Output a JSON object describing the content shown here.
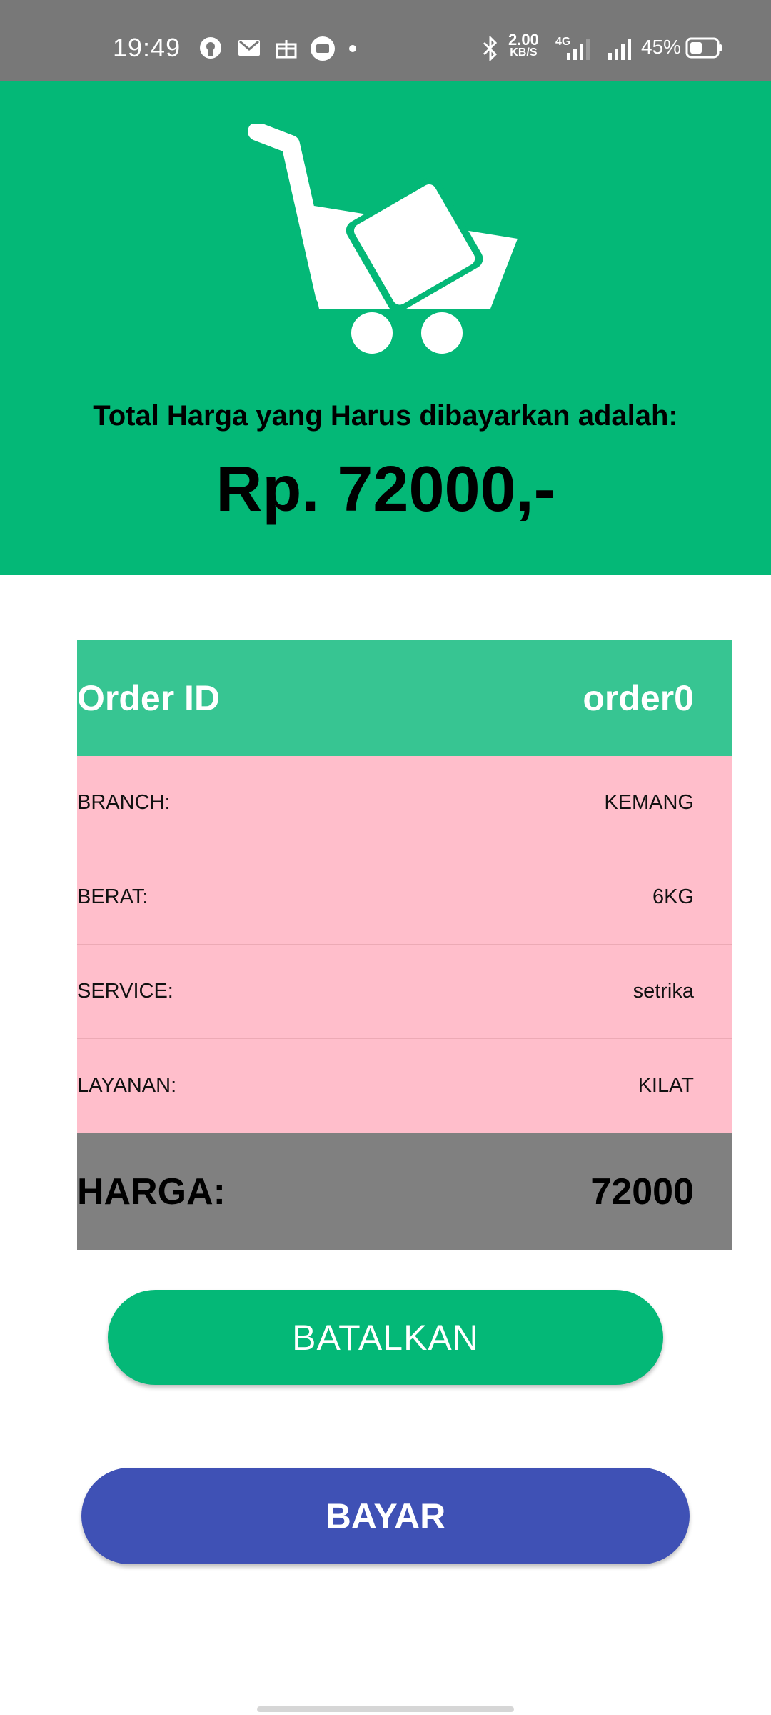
{
  "status_bar": {
    "time": "19:49",
    "net_speed_value": "2.00",
    "net_speed_unit": "KB/S",
    "network_type": "4G",
    "battery": "45%"
  },
  "hero": {
    "icon": "shopping-cart-icon",
    "subtitle": "Total Harga yang Harus dibayarkan adalah:",
    "total": "Rp. 72000,-"
  },
  "order": {
    "header_label": "Order ID",
    "header_value": "order0",
    "rows": [
      {
        "label": "BRANCH:",
        "value": "KEMANG"
      },
      {
        "label": "BERAT:",
        "value": "6KG"
      },
      {
        "label": "SERVICE:",
        "value": "setrika"
      },
      {
        "label": "LAYANAN:",
        "value": "KILAT"
      }
    ],
    "price_label": "HARGA:",
    "price_value": "72000"
  },
  "buttons": {
    "cancel_label": "BATALKAN",
    "pay_label": "BAYAR"
  },
  "colors": {
    "primary_green": "#04b877",
    "header_green": "#37c592",
    "row_pink": "#ffbecb",
    "footer_gray": "#808080",
    "pay_blue": "#3f51b5",
    "status_bar": "#787878"
  }
}
